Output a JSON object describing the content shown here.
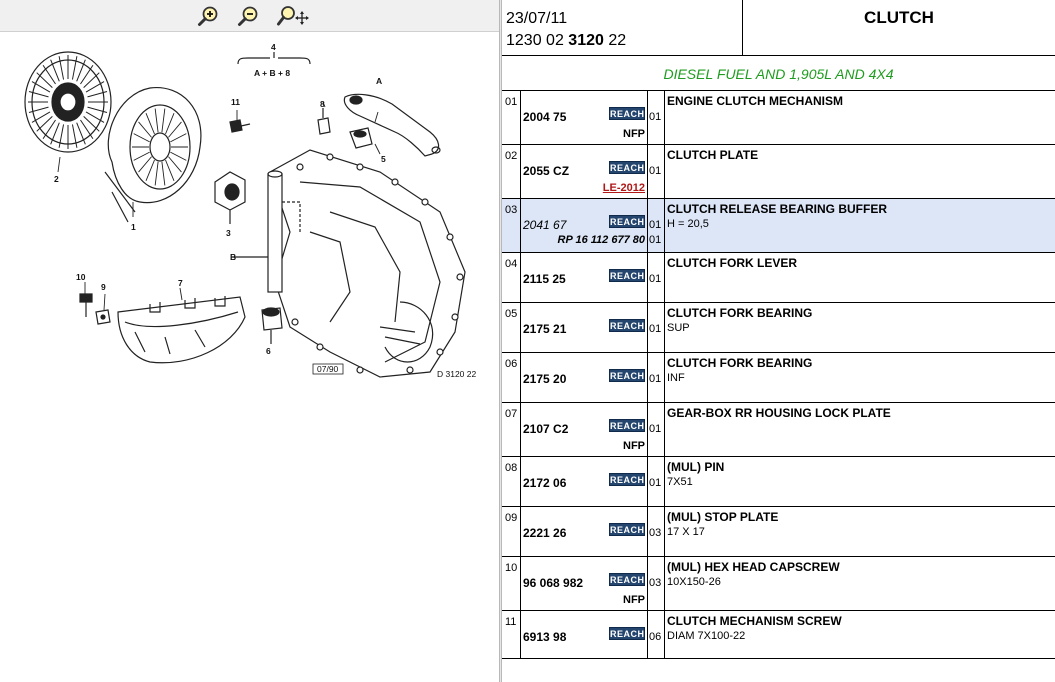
{
  "toolbar": {
    "zoom_in_icon": "zoom-in-icon",
    "zoom_out_icon": "zoom-out-icon",
    "zoom_pan_icon": "zoom-pan-icon"
  },
  "diagram": {
    "labels": [
      "1",
      "2",
      "3",
      "4",
      "A + B + 8",
      "5",
      "6",
      "7",
      "8",
      "9",
      "10",
      "11",
      "A",
      "B"
    ],
    "stamp": "07/90",
    "code": "D 3120 22"
  },
  "header": {
    "date": "23/07/11",
    "ref_prefix": "1230 02",
    "ref_bold": "3120",
    "ref_suffix": "22",
    "title": "CLUTCH"
  },
  "subheader": "DIESEL FUEL AND 1,905L AND 4X4",
  "reach_label": "REACH",
  "rows": [
    {
      "num": "01",
      "ref": "2004 75",
      "qty": "01",
      "flag": "NFP",
      "desc": "ENGINE CLUTCH MECHANISM",
      "sub": ""
    },
    {
      "num": "02",
      "ref": "2055 CZ",
      "qty": "01",
      "flag": "LE-2012",
      "desc": "CLUTCH PLATE",
      "sub": ""
    },
    {
      "num": "03",
      "ref": "2041 67",
      "qty": "01",
      "qty2": "01",
      "flag": "RP 16 112 677 80",
      "desc": "CLUTCH RELEASE BEARING BUFFER",
      "sub": "H = 20,5"
    },
    {
      "num": "04",
      "ref": "2115 25",
      "qty": "01",
      "flag": "",
      "desc": "CLUTCH FORK LEVER",
      "sub": ""
    },
    {
      "num": "05",
      "ref": "2175 21",
      "qty": "01",
      "flag": "",
      "desc": "CLUTCH FORK BEARING",
      "sub": "SUP"
    },
    {
      "num": "06",
      "ref": "2175 20",
      "qty": "01",
      "flag": "",
      "desc": "CLUTCH FORK BEARING",
      "sub": "INF"
    },
    {
      "num": "07",
      "ref": "2107 C2",
      "qty": "01",
      "flag": "NFP",
      "desc": "GEAR-BOX RR HOUSING LOCK PLATE",
      "sub": ""
    },
    {
      "num": "08",
      "ref": "2172 06",
      "qty": "01",
      "flag": "",
      "desc": "(MUL) PIN",
      "sub": "7X51"
    },
    {
      "num": "09",
      "ref": "2221 26",
      "qty": "03",
      "flag": "",
      "desc": "(MUL) STOP PLATE",
      "sub": "17 X 17"
    },
    {
      "num": "10",
      "ref": "96 068 982",
      "qty": "03",
      "flag": "NFP",
      "desc": "(MUL) HEX HEAD CAPSCREW",
      "sub": "10X150-26"
    },
    {
      "num": "11",
      "ref": "6913 98",
      "qty": "06",
      "flag": "",
      "desc": "CLUTCH MECHANISM SCREW",
      "sub": "DIAM 7X100-22"
    }
  ],
  "colors": {
    "subheader_green": "#1e9c1e",
    "highlight_row": "#dce6f7",
    "reach_badge": "#24456e",
    "le_red": "#b01818"
  }
}
